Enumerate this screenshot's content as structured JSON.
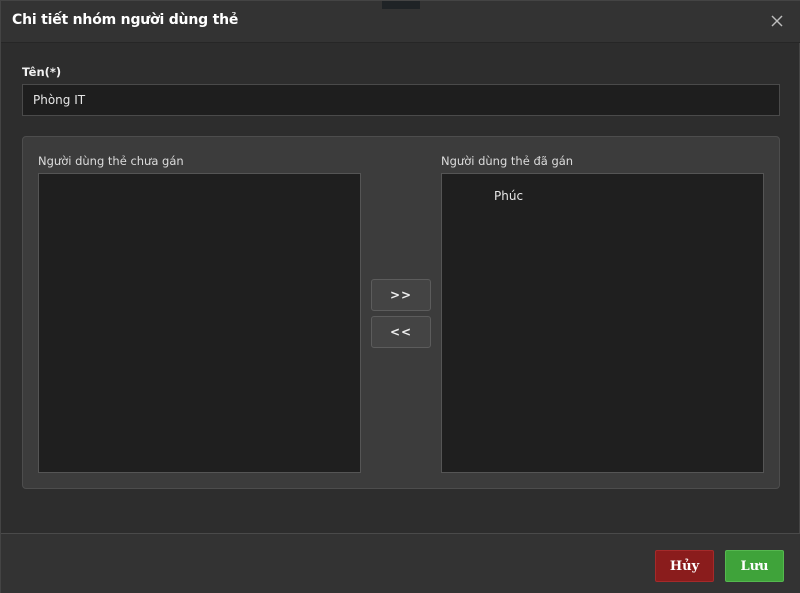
{
  "dialog": {
    "title": "Chi tiết nhóm người dùng thẻ",
    "close_icon": "close-icon"
  },
  "form": {
    "name_label": "Tên(*)",
    "name_value": "Phòng IT"
  },
  "unassigned": {
    "label": "Người dùng thẻ chưa gán",
    "items": []
  },
  "assigned": {
    "label": "Người dùng thẻ đã gán",
    "items": [
      "Phúc"
    ]
  },
  "transfer": {
    "add_label": ">>",
    "remove_label": "<<"
  },
  "footer": {
    "cancel_label": "Hủy",
    "save_label": "Lưu"
  },
  "colors": {
    "cancel": "#8a1c1c",
    "save": "#3fa33a",
    "background": "#2d2d2d",
    "panel": "#3c3c3c"
  }
}
